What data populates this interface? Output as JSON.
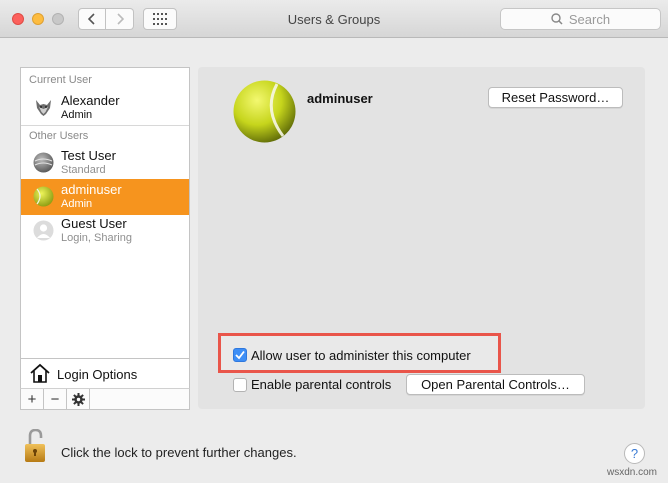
{
  "window": {
    "title": "Users & Groups",
    "search_placeholder": "Search"
  },
  "sidebar": {
    "current_user_heading": "Current User",
    "other_users_heading": "Other Users",
    "users": [
      {
        "name": "Alexander",
        "role": "Admin",
        "avatar": "wolf-avatar-icon",
        "selected": false
      },
      {
        "name": "Test User",
        "role": "Standard",
        "avatar": "gray-ball-avatar-icon",
        "selected": false
      },
      {
        "name": "adminuser",
        "role": "Admin",
        "avatar": "tennis-ball-avatar-icon",
        "selected": true
      },
      {
        "name": "Guest User",
        "role": "Login, Sharing",
        "avatar": "person-silhouette-icon",
        "selected": false
      }
    ],
    "login_options_label": "Login Options",
    "toolbar": {
      "add": "+",
      "remove": "−"
    }
  },
  "detail": {
    "username": "adminuser",
    "reset_password_label": "Reset Password…",
    "allow_admin_label": "Allow user to administer this computer",
    "allow_admin_checked": true,
    "parental_label": "Enable parental controls",
    "parental_checked": false,
    "open_parental_label": "Open Parental Controls…"
  },
  "footer": {
    "lock_text": "Click the lock to prevent further changes.",
    "help_label": "?"
  },
  "watermark": "wsxdn.com",
  "colors": {
    "selection": "#f6941e",
    "highlight_border": "#e9554a",
    "checkbox_on": "#3d8ef6"
  }
}
